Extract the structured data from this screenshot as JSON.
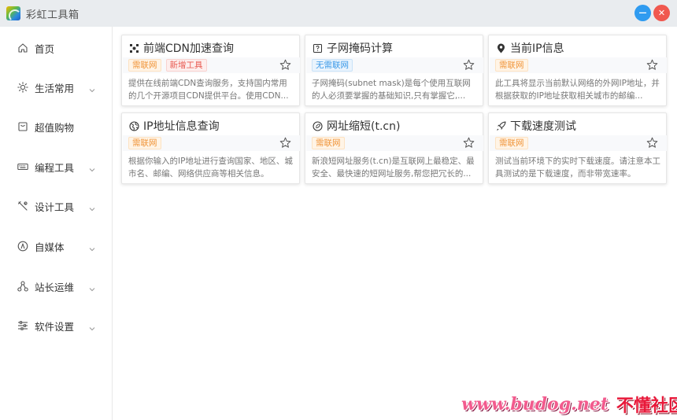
{
  "app": {
    "title": "彩虹工具箱",
    "minimize_glyph": "—",
    "close_glyph": "✕"
  },
  "sidebar": {
    "items": [
      {
        "label": "首页",
        "icon": "home-icon",
        "expandable": false
      },
      {
        "label": "生活常用",
        "icon": "sun-icon",
        "expandable": true
      },
      {
        "label": "超值购物",
        "icon": "shopping-icon",
        "expandable": false
      },
      {
        "label": "编程工具",
        "icon": "keyboard-icon",
        "expandable": true
      },
      {
        "label": "设计工具",
        "icon": "design-tools-icon",
        "expandable": true
      },
      {
        "label": "自媒体",
        "icon": "compass-icon",
        "expandable": true
      },
      {
        "label": "站长运维",
        "icon": "network-icon",
        "expandable": true
      },
      {
        "label": "软件设置",
        "icon": "settings-sliders-icon",
        "expandable": true
      }
    ]
  },
  "cards": [
    {
      "title": "前端CDN加速查询",
      "icon": "cdn-icon",
      "tags": [
        {
          "text": "需联网",
          "color": "orange"
        },
        {
          "text": "新增工具",
          "color": "red"
        }
      ],
      "description": "提供在线前端CDN查询服务，支持国内常用的几个开源项目CDN提供平台。使用CDN..."
    },
    {
      "title": "子网掩码计算",
      "icon": "subnet-icon",
      "tags": [
        {
          "text": "无需联网",
          "color": "blue"
        }
      ],
      "description": "子网掩码(subnet mask)是每个使用互联网的人必须要掌握的基础知识,只有掌握它,..."
    },
    {
      "title": "当前IP信息",
      "icon": "location-pin-icon",
      "tags": [
        {
          "text": "需联网",
          "color": "orange"
        }
      ],
      "description": "此工具将显示当前默认网络的外网IP地址，并根据获取的IP地址获取相关城市的邮编..."
    },
    {
      "title": "IP地址信息查询",
      "icon": "globe-icon",
      "tags": [
        {
          "text": "需联网",
          "color": "orange"
        }
      ],
      "description": "根据你输入的IP地址进行查询国家、地区、城市名、邮编、网络供应商等相关信息。"
    },
    {
      "title": "网址缩短(t.cn)",
      "icon": "link-icon",
      "tags": [
        {
          "text": "需联网",
          "color": "orange"
        }
      ],
      "description": "新浪短网址服务(t.cn)是互联网上最稳定、最安全、最快速的短网址服务,帮您把冗长的..."
    },
    {
      "title": "下载速度测试",
      "icon": "rocket-icon",
      "tags": [
        {
          "text": "需联网",
          "color": "orange"
        }
      ],
      "description": "测试当前环境下的实时下载速度。请注意本工具测试的是下载速度，而非带宽速率。"
    }
  ],
  "watermark": {
    "url": "www.budog.net",
    "text": "不懂社区"
  },
  "colors": {
    "titlebar_bg": "#e9ecef",
    "minimize": "#2f9bf0",
    "close": "#f0584f",
    "tag_orange": "#f0953a",
    "tag_red": "#e8584f",
    "tag_blue": "#3c9ae8"
  }
}
